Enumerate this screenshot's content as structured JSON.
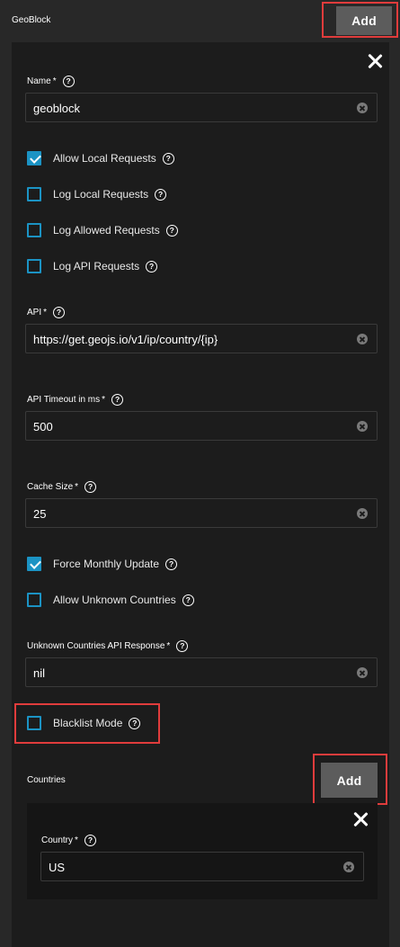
{
  "header": {
    "title": "GeoBlock",
    "add_label": "Add"
  },
  "form": {
    "name": {
      "label": "Name",
      "required": "*",
      "value": "geoblock"
    },
    "checkboxes": [
      {
        "label": "Allow Local Requests",
        "checked": true
      },
      {
        "label": "Log Local Requests",
        "checked": false
      },
      {
        "label": "Log Allowed Requests",
        "checked": false
      },
      {
        "label": "Log API Requests",
        "checked": false
      }
    ],
    "api": {
      "label": "API",
      "required": "*",
      "value": "https://get.geojs.io/v1/ip/country/{ip}"
    },
    "api_timeout": {
      "label": "API Timeout in ms",
      "required": "*",
      "value": "500"
    },
    "cache_size": {
      "label": "Cache Size",
      "required": "*",
      "value": "25"
    },
    "force_monthly_update": {
      "label": "Force Monthly Update",
      "checked": true
    },
    "allow_unknown_countries": {
      "label": "Allow Unknown Countries",
      "checked": false
    },
    "unknown_countries_api_response": {
      "label": "Unknown Countries API Response",
      "required": "*",
      "value": "nil"
    },
    "blacklist_mode": {
      "label": "Blacklist Mode",
      "checked": false
    }
  },
  "countries": {
    "title": "Countries",
    "add_label": "Add",
    "items": [
      {
        "label": "Country",
        "required": "*",
        "value": "US"
      }
    ]
  },
  "icons": {
    "help": "?"
  },
  "colors": {
    "accent": "#1b93c4",
    "highlight": "#e03c3c",
    "button": "#5c5c5c"
  }
}
